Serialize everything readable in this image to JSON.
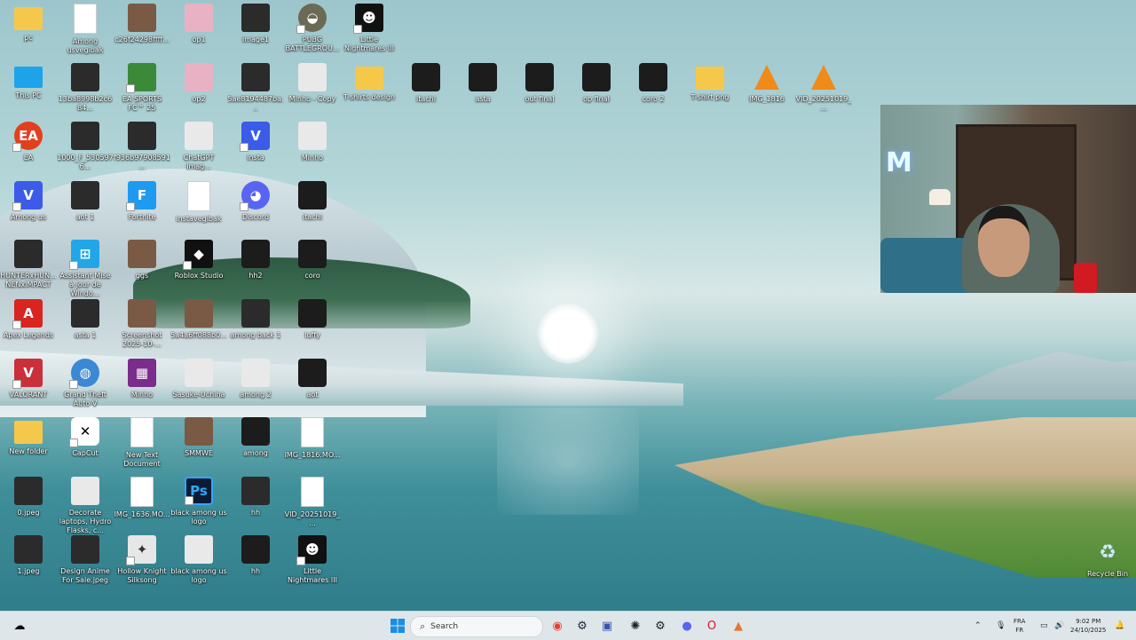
{
  "desktop": {
    "icons": [
      {
        "label": "pc",
        "kind": "folder",
        "col": 0,
        "row": 0
      },
      {
        "label": "Among usvegibak",
        "kind": "doc",
        "col": 1,
        "row": 0
      },
      {
        "label": "c26f24298ffff...",
        "kind": "photo",
        "col": 2,
        "row": 0
      },
      {
        "label": "op1",
        "kind": "pink",
        "col": 3,
        "row": 0
      },
      {
        "label": "image1",
        "kind": "dark",
        "col": 4,
        "row": 0
      },
      {
        "label": "PUBG BATTLEGROU...",
        "kind": "pubg",
        "col": 5,
        "row": 0
      },
      {
        "label": "Little Nightmares III",
        "kind": "ln",
        "col": 6,
        "row": 0
      },
      {
        "label": "This PC",
        "kind": "pc",
        "col": 0,
        "row": 1
      },
      {
        "label": "13ba8998b2c684...",
        "kind": "dark",
        "col": 1,
        "row": 1
      },
      {
        "label": "EA SPORTS FC™ 25",
        "kind": "field",
        "col": 2,
        "row": 1
      },
      {
        "label": "op2",
        "kind": "pink",
        "col": 3,
        "row": 1
      },
      {
        "label": "5ae8194487ba...",
        "kind": "dark",
        "col": 4,
        "row": 1
      },
      {
        "label": "Minho - Copy",
        "kind": "light",
        "col": 5,
        "row": 1
      },
      {
        "label": "T-shirts design",
        "kind": "folder",
        "col": 6,
        "row": 1
      },
      {
        "label": "itachi",
        "kind": "tee",
        "col": 7,
        "row": 1
      },
      {
        "label": "asta",
        "kind": "tee",
        "col": 8,
        "row": 1
      },
      {
        "label": "out final",
        "kind": "tee",
        "col": 9,
        "row": 1
      },
      {
        "label": "op final",
        "kind": "tee",
        "col": 10,
        "row": 1
      },
      {
        "label": "coro 2",
        "kind": "tee",
        "col": 11,
        "row": 1
      },
      {
        "label": "T-shirt png",
        "kind": "folder",
        "col": 12,
        "row": 1
      },
      {
        "label": "IMG_1816",
        "kind": "vlc",
        "col": 13,
        "row": 1
      },
      {
        "label": "VID_20251019_...",
        "kind": "vlc",
        "col": 14,
        "row": 1
      },
      {
        "label": "EA",
        "kind": "ea",
        "col": 0,
        "row": 2
      },
      {
        "label": "1000_F_5305976...",
        "kind": "dark",
        "col": 1,
        "row": 2
      },
      {
        "label": "f936b97908591...",
        "kind": "dark",
        "col": 2,
        "row": 2
      },
      {
        "label": "ChatGPT Imag...",
        "kind": "light",
        "col": 3,
        "row": 2
      },
      {
        "label": "insta",
        "kind": "v",
        "col": 4,
        "row": 2
      },
      {
        "label": "Minho",
        "kind": "light",
        "col": 5,
        "row": 2
      },
      {
        "label": "Among us",
        "kind": "v",
        "col": 0,
        "row": 3
      },
      {
        "label": "aot 1",
        "kind": "dark",
        "col": 1,
        "row": 3
      },
      {
        "label": "Fortnite",
        "kind": "fort",
        "col": 2,
        "row": 3
      },
      {
        "label": "instavegibak",
        "kind": "doc",
        "col": 3,
        "row": 3
      },
      {
        "label": "Discord",
        "kind": "discord",
        "col": 4,
        "row": 3
      },
      {
        "label": "itachi",
        "kind": "tee",
        "col": 5,
        "row": 3
      },
      {
        "label": "HUNTERxHUN... NENxIMPACT",
        "kind": "dark",
        "col": 0,
        "row": 4
      },
      {
        "label": "Assistant Mise à jour de Windo...",
        "kind": "win",
        "col": 1,
        "row": 4
      },
      {
        "label": "ggs",
        "kind": "photo",
        "col": 2,
        "row": 4
      },
      {
        "label": "Roblox Studio",
        "kind": "roblox",
        "col": 3,
        "row": 4
      },
      {
        "label": "hh2",
        "kind": "tee",
        "col": 4,
        "row": 4
      },
      {
        "label": "coro",
        "kind": "tee",
        "col": 5,
        "row": 4
      },
      {
        "label": "Apex Legends",
        "kind": "apex",
        "col": 0,
        "row": 5
      },
      {
        "label": "asta 1",
        "kind": "dark",
        "col": 1,
        "row": 5
      },
      {
        "label": "Screenshot 2025-10-...",
        "kind": "photo",
        "col": 2,
        "row": 5
      },
      {
        "label": "5a4a6ff088b0...",
        "kind": "photo",
        "col": 3,
        "row": 5
      },
      {
        "label": "among back 1",
        "kind": "dark",
        "col": 4,
        "row": 5
      },
      {
        "label": "luffy",
        "kind": "tee",
        "col": 5,
        "row": 5
      },
      {
        "label": "VALORANT",
        "kind": "valorant",
        "col": 0,
        "row": 6
      },
      {
        "label": "Grand Theft Auto V",
        "kind": "gta",
        "col": 1,
        "row": 6
      },
      {
        "label": "Minho",
        "kind": "winrar",
        "col": 2,
        "row": 6
      },
      {
        "label": "Sasuke-Uchiha",
        "kind": "light",
        "col": 3,
        "row": 6
      },
      {
        "label": "among 2",
        "kind": "light",
        "col": 4,
        "row": 6
      },
      {
        "label": "aot",
        "kind": "tee",
        "col": 5,
        "row": 6
      },
      {
        "label": "New folder",
        "kind": "folder",
        "col": 0,
        "row": 7
      },
      {
        "label": "CapCut",
        "kind": "capcut",
        "col": 1,
        "row": 7
      },
      {
        "label": "New Text Document",
        "kind": "doc",
        "col": 2,
        "row": 7
      },
      {
        "label": "SMMWE",
        "kind": "photo",
        "col": 3,
        "row": 7
      },
      {
        "label": "among",
        "kind": "tee",
        "col": 4,
        "row": 7
      },
      {
        "label": "IMG_1816.MO...",
        "kind": "doc",
        "col": 5,
        "row": 7
      },
      {
        "label": "0.jpeg",
        "kind": "dark",
        "col": 0,
        "row": 8
      },
      {
        "label": "Decorate laptops, Hydro Flasks, c...",
        "kind": "light",
        "col": 1,
        "row": 8
      },
      {
        "label": "IMG_1636.MO...",
        "kind": "doc",
        "col": 2,
        "row": 8
      },
      {
        "label": "black among us logo",
        "kind": "ps",
        "col": 3,
        "row": 8
      },
      {
        "label": "hh",
        "kind": "dark",
        "col": 4,
        "row": 8
      },
      {
        "label": "VID_20251019_...",
        "kind": "doc",
        "col": 5,
        "row": 8
      },
      {
        "label": "1.jpeg",
        "kind": "dark",
        "col": 0,
        "row": 9
      },
      {
        "label": "Design Anime For Sale.jpeg",
        "kind": "dark",
        "col": 1,
        "row": 9
      },
      {
        "label": "Hollow Knight Silksong",
        "kind": "hk",
        "col": 2,
        "row": 9
      },
      {
        "label": "black among us logo",
        "kind": "light",
        "col": 3,
        "row": 9
      },
      {
        "label": "hh",
        "kind": "tee",
        "col": 4,
        "row": 9
      },
      {
        "label": "Little Nightmares III",
        "kind": "ln",
        "col": 5,
        "row": 9
      }
    ],
    "recycle_bin": "Recycle Bin"
  },
  "taskbar": {
    "search_placeholder": "Search",
    "apps": [
      "start",
      "search",
      "chrome",
      "steam",
      "app-generic",
      "chatgpt",
      "steam-alt",
      "discord",
      "opera",
      "lens"
    ],
    "lang_top": "FRA",
    "lang_bottom": "FR",
    "time": "9:02 PM",
    "date": "24/10/2025"
  }
}
